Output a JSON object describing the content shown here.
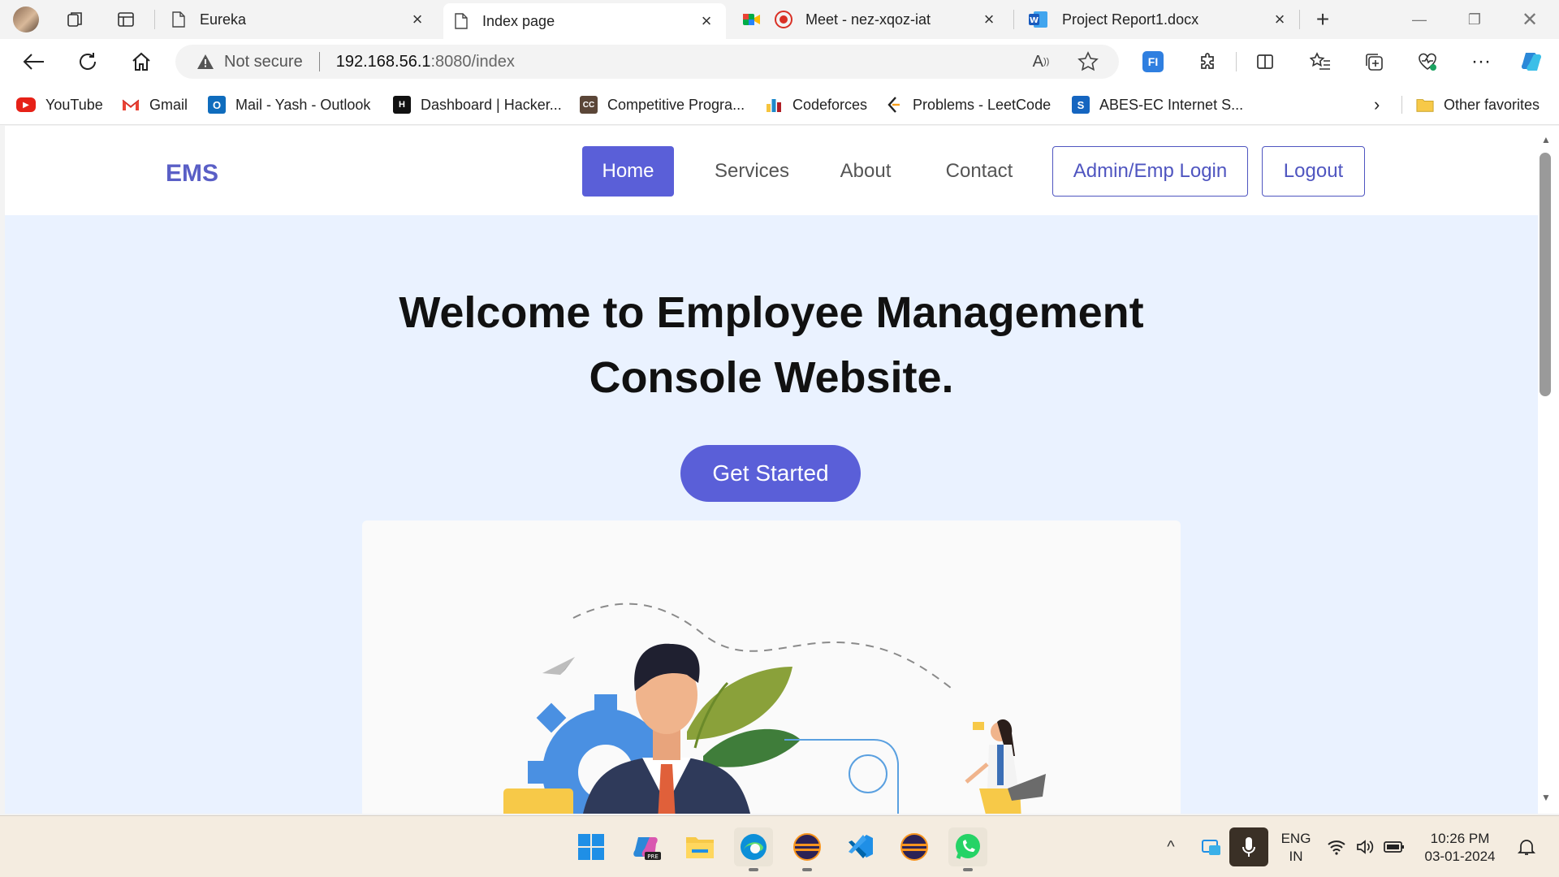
{
  "browser": {
    "tabs": [
      {
        "title": "Eureka",
        "icon": "page-icon"
      },
      {
        "title": "Index page",
        "icon": "page-icon",
        "active": true
      },
      {
        "title": "Meet - nez-xqoz-iat",
        "icon": "meet-icon"
      },
      {
        "title": "Project Report1.docx",
        "icon": "word-icon"
      }
    ],
    "address": {
      "security": "Not secure",
      "host": "192.168.56.1",
      "path": ":8080/index"
    },
    "bookmarks": [
      {
        "label": "YouTube",
        "icon": "youtube-icon",
        "color": "#e62117"
      },
      {
        "label": "Gmail",
        "icon": "gmail-icon",
        "color": "#ea4335"
      },
      {
        "label": "Mail - Yash - Outlook",
        "icon": "outlook-icon",
        "color": "#0f6cbd"
      },
      {
        "label": "Dashboard | Hacker...",
        "icon": "hackerrank-icon",
        "color": "#111111"
      },
      {
        "label": "Competitive Progra...",
        "icon": "codechef-icon",
        "color": "#5b4638"
      },
      {
        "label": "Codeforces",
        "icon": "codeforces-icon",
        "color": "#1f8acb"
      },
      {
        "label": "Problems - LeetCode",
        "icon": "leetcode-icon",
        "color": "#f89f1b"
      },
      {
        "label": "ABES-EC Internet S...",
        "icon": "abes-icon",
        "color": "#1565c0"
      }
    ],
    "other_favorites": "Other favorites"
  },
  "site": {
    "brand": "EMS",
    "nav": {
      "home": "Home",
      "services": "Services",
      "about": "About",
      "contact": "Contact",
      "login": "Admin/Emp Login",
      "logout": "Logout"
    },
    "hero": {
      "line1": "Welcome to Employee Management",
      "line2": "Console Website.",
      "cta": "Get Started"
    },
    "accent": "#5a5fd8"
  },
  "taskbar": {
    "lang_line1": "ENG",
    "lang_line2": "IN",
    "time": "10:26 PM",
    "date": "03-01-2024",
    "apps": [
      "start-icon",
      "copilot-icon",
      "file-explorer-icon",
      "edge-icon",
      "eclipse-icon",
      "vscode-icon",
      "eclipse-icon",
      "whatsapp-icon"
    ]
  }
}
